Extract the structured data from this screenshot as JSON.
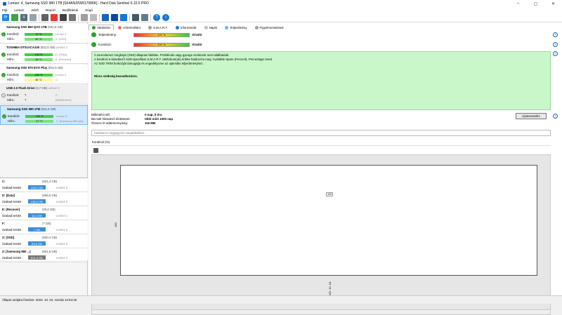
{
  "window": {
    "title": "Lemez: 4, Samsung SSD 980 1TB [S64ANJ0W917086K] - Hard Disk Sentinel 6.10.5 PRO"
  },
  "menu": [
    "Fájl",
    "Lemez",
    "Jelzõ",
    "Report",
    "Beállítások",
    "Súgó"
  ],
  "disks": [
    {
      "name": "Samsung SSD 860 QVO 1TB",
      "size": "(931,5 GB)",
      "cond_label": "Kondíció:",
      "cond": "97 %",
      "temp_label": "Hőm.:",
      "temp": "42 °C",
      "x1": "Lemez 0",
      "x2": "S: [SSD]",
      "status": "ok"
    },
    {
      "name": "TOSHIBA DT01ACA100",
      "size": "(931,5 GB)",
      "extra": "Lemez 1",
      "cond_label": "Kondíció:",
      "cond": "100 %",
      "temp_label": "Hőm.:",
      "temp": "34 °C",
      "x1": "D: [Data],",
      "x2": "E: [Recover]",
      "status": "ok"
    },
    {
      "name": "Samsung SSD 970 EVO Plus",
      "size": "(931,5 GB)",
      "cond_label": "Kondíció:",
      "cond": "100 %",
      "temp_label": "Hőm.:",
      "temp": "45 °C",
      "x1": "Lemez 2",
      "x2": "C:",
      "status": "ok"
    },
    {
      "name": "USB 2.0 Flash Drive",
      "size": "(3,7 GB)",
      "extra": "Lemez 3",
      "cond_label": "Kondíció:",
      "cond": "?",
      "temp_label": "Hőm.:",
      "temp": "?",
      "x1": "F:",
      "x2": "[SAMSUNG]",
      "status": "unknown"
    },
    {
      "name": "Samsung SSD 980 1TB",
      "size": "(931,5 GB)",
      "cond_label": "Kondíció:",
      "cond": "100 %",
      "temp_label": "Hőm.:",
      "temp": "27 °C",
      "x1": "Lemez 4",
      "x2": "Z: [Samsung 980 pro]",
      "status": "ok"
    }
  ],
  "volumes": [
    {
      "name": "C:",
      "size": "(931,4 GB)",
      "free_label": "Szabad terület",
      "free": "248,1 GB",
      "disk": "Lemez 2"
    },
    {
      "name": "D: [Data]",
      "size": "(906,5 GB)",
      "free_label": "Szabad terület",
      "free": "238,9 GB",
      "disk": "Lemez 1"
    },
    {
      "name": "E: [Recover]",
      "size": "(25,0 GB)",
      "free_label": "Szabad terület",
      "free": "16,1 GB",
      "disk": "Lemez 1"
    },
    {
      "name": "F:",
      "size": "(7 GB)",
      "free_label": "Szabad terület",
      "free": "7 GB",
      "disk": "Lemez 3"
    },
    {
      "name": "S: [SSD]",
      "size": "(930,4 GB)",
      "free_label": "Szabad terület",
      "free": "95,6 GB",
      "disk": "Lemez 0"
    },
    {
      "name": "Z: [Samsung 980 ...]",
      "size": "(931,5 GB)",
      "free_label": "Szabad terület",
      "free": "631,4 GB",
      "disk": "Lemez 4"
    }
  ],
  "tabs": [
    "Áttekintés",
    "Hőmérséklet",
    "S.M.A.R.T.",
    "Információk",
    "Napló",
    "Teljesítmény",
    "Figyelmeztetések"
  ],
  "perf": {
    "label": "Teljesítmény:",
    "value": "100 %",
    "text": "Kiváló"
  },
  "health": {
    "label": "Kondíció:",
    "value": "100 %",
    "text": "Kiváló"
  },
  "message": {
    "lines": [
      "A merevlemez meghajtó (SSD) állapota hibátlan. Problémás vagy gyenge szektorok nem találhatóak.",
      "A kondíció a következő SSD-specifikus S.M.A.R.T. attribútum(ok) értéke határozza meg:  Available Spare (Percent), Percentage Used",
      "Az SSD TRIM funkcióját támogatja és engedélyezve az optimális teljesítményhez."
    ],
    "action": "Nincs szükség beavatkozásra."
  },
  "stats": [
    {
      "k": "Működési idő:",
      "v": "0 nap, 0 óra"
    },
    {
      "k": "Becsült hátralevő élettartam:",
      "v": "több mint 1000 nap"
    },
    {
      "k": "Összes írt adatmennyiség:",
      "v": "116 MB"
    }
  ],
  "refresh_label": "Újratesztelés",
  "comment_placeholder": "Kattintson megjegyzés megadásához...",
  "chart_tab": "Kondíció  (%)",
  "chart_data": {
    "type": "line",
    "x": [
      "2023. 10. 04."
    ],
    "values": [
      100
    ],
    "ylabel": "",
    "ytick": "100",
    "point_label": "100",
    "ylim": [
      0,
      100
    ]
  },
  "status": "Állapot utoljára frissítve: 2023. 10. 04. szerda 12:54:25"
}
